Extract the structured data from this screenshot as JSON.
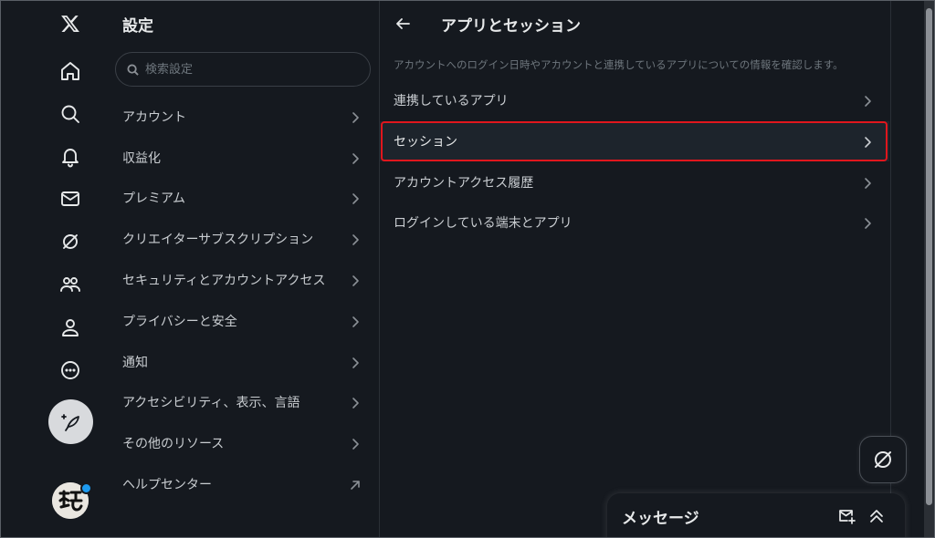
{
  "nav": {
    "items": [
      {
        "name": "x-logo-icon"
      },
      {
        "name": "home-icon"
      },
      {
        "name": "search-icon"
      },
      {
        "name": "notifications-bell-icon"
      },
      {
        "name": "messages-mail-icon"
      },
      {
        "name": "grok-icon"
      },
      {
        "name": "communities-icon"
      },
      {
        "name": "profile-icon"
      },
      {
        "name": "more-circle-icon"
      }
    ],
    "compose_icon": "compose-post-icon",
    "avatar_badge_color": "#1d9bf0"
  },
  "settings": {
    "title": "設定",
    "search_placeholder": "検索設定",
    "items": [
      {
        "label": "アカウント",
        "icon": "chevron-right-icon"
      },
      {
        "label": "収益化",
        "icon": "chevron-right-icon"
      },
      {
        "label": "プレミアム",
        "icon": "chevron-right-icon"
      },
      {
        "label": "クリエイターサブスクリプション",
        "icon": "chevron-right-icon"
      },
      {
        "label": "セキュリティとアカウントアクセス",
        "icon": "chevron-right-icon"
      },
      {
        "label": "プライバシーと安全",
        "icon": "chevron-right-icon"
      },
      {
        "label": "通知",
        "icon": "chevron-right-icon"
      },
      {
        "label": "アクセシビリティ、表示、言語",
        "icon": "chevron-right-icon"
      },
      {
        "label": "その他のリソース",
        "icon": "chevron-right-icon"
      },
      {
        "label": "ヘルプセンター",
        "icon": "external-link-arrow-icon"
      }
    ]
  },
  "detail": {
    "title": "アプリとセッション",
    "description": "アカウントへのログイン日時やアカウントと連携しているアプリについての情報を確認します。",
    "items": [
      {
        "label": "連携しているアプリ",
        "selected": false
      },
      {
        "label": "セッション",
        "selected": true
      },
      {
        "label": "アカウントアクセス履歴",
        "selected": false
      },
      {
        "label": "ログインしている端末とアプリ",
        "selected": false
      }
    ],
    "highlight_color": "#e0161d"
  },
  "messages": {
    "title": "メッセージ"
  },
  "colors": {
    "background": "#15191f",
    "text": "#e7e9ea",
    "muted": "#6e767d",
    "accent": "#1d9bf0"
  }
}
